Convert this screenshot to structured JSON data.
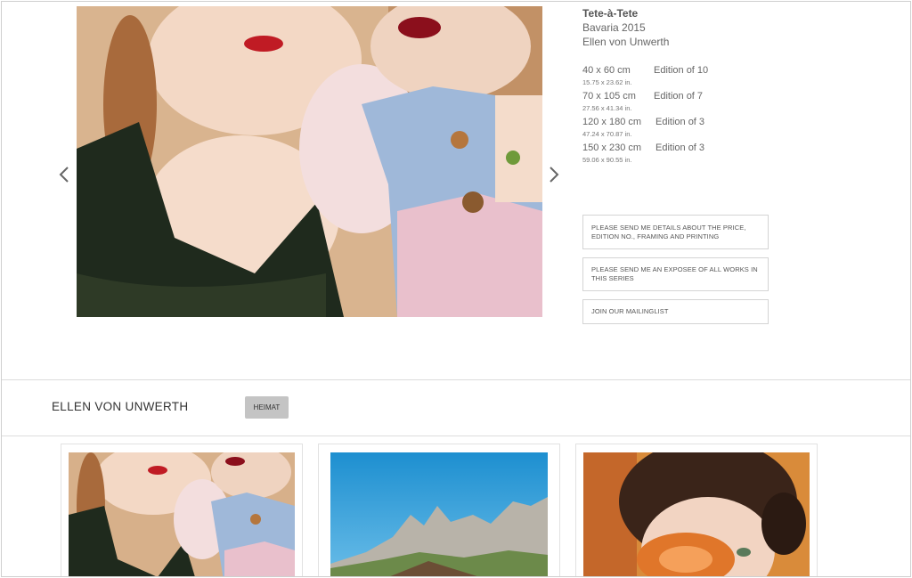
{
  "artwork": {
    "title": "Tete-à-Tete",
    "series_year": "Bavaria 2015",
    "artist": "Ellen von Unwerth",
    "sizes": [
      {
        "cm": "40 x 60 cm",
        "inches": "15.75 x 23.62 in.",
        "edition": "Edition of 10"
      },
      {
        "cm": "70 x 105 cm",
        "inches": "27.56 x 41.34 in.",
        "edition": "Edition of 7"
      },
      {
        "cm": "120 x 180 cm",
        "inches": "47.24 x 70.87 in.",
        "edition": "Edition of 3"
      },
      {
        "cm": "150 x 230 cm",
        "inches": "59.06 x 90.55 in.",
        "edition": "Edition of 3"
      }
    ]
  },
  "actions": {
    "price_details": "PLEASE SEND ME DETAILS ABOUT THE PRICE, EDITION NO., FRAMING AND PRINTING",
    "exposee": "PLEASE SEND ME AN EXPOSEE OF ALL WORKS IN THIS SERIES",
    "mailinglist": "JOIN OUR MAILINGLIST"
  },
  "nav": {
    "prev_icon": "chevron-left-icon",
    "next_icon": "chevron-right-icon"
  },
  "series": {
    "artist_heading": "ELLEN VON UNWERTH",
    "tag": "HEIMAT"
  },
  "colors": {
    "tag_background": "#c4c4c4",
    "border": "#d4d4d4",
    "text": "#555555"
  }
}
